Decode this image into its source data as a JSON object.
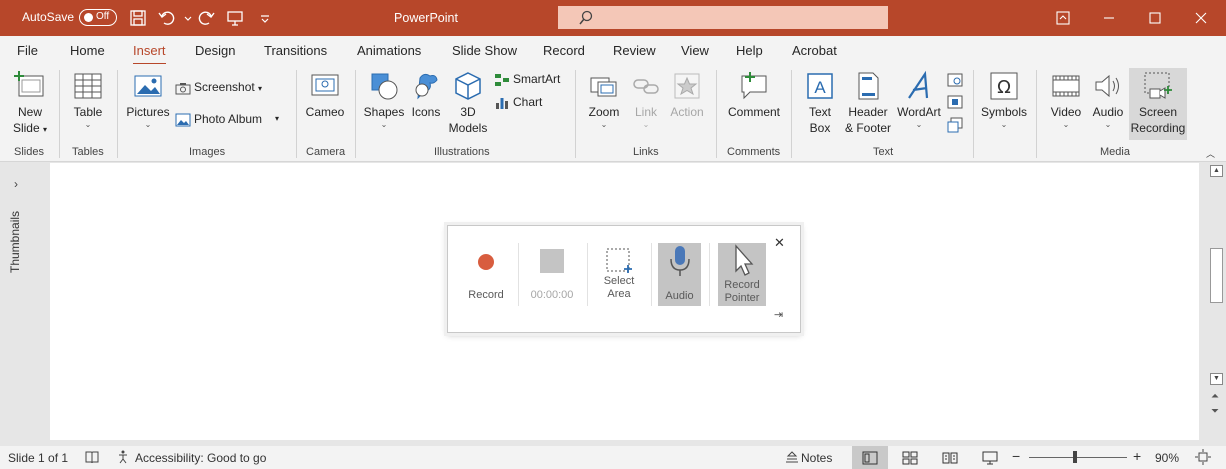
{
  "titlebar": {
    "autosave_label": "AutoSave",
    "autosave_state": "Off",
    "app_title": "PowerPoint"
  },
  "tabs": [
    "File",
    "Home",
    "Insert",
    "Design",
    "Transitions",
    "Animations",
    "Slide Show",
    "Record",
    "Review",
    "View",
    "Help",
    "Acrobat"
  ],
  "active_tab": "Insert",
  "ribbon": {
    "new_slide": [
      "New",
      "Slide"
    ],
    "table": "Table",
    "pictures": "Pictures",
    "screenshot": "Screenshot",
    "photo_album": "Photo Album",
    "cameo": "Cameo",
    "shapes": "Shapes",
    "icons": "Icons",
    "models": [
      "3D",
      "Models"
    ],
    "smartart": "SmartArt",
    "chart": "Chart",
    "zoom": "Zoom",
    "link": "Link",
    "action": "Action",
    "comment": "Comment",
    "textbox": [
      "Text",
      "Box"
    ],
    "header_footer": [
      "Header",
      "& Footer"
    ],
    "wordart": "WordArt",
    "symbols": "Symbols",
    "video": "Video",
    "audio": "Audio",
    "screen_recording": [
      "Screen",
      "Recording"
    ],
    "groups": {
      "slides": "Slides",
      "tables": "Tables",
      "images": "Images",
      "camera": "Camera",
      "illustrations": "Illustrations",
      "links": "Links",
      "comments": "Comments",
      "text": "Text",
      "media": "Media"
    }
  },
  "thumbnails_label": "Thumbnails",
  "recorder": {
    "record": "Record",
    "time": "00:00:00",
    "select_area": [
      "Select",
      "Area"
    ],
    "audio": "Audio",
    "record_pointer": [
      "Record",
      "Pointer"
    ]
  },
  "statusbar": {
    "slide_info": "Slide 1 of 1",
    "accessibility": "Accessibility: Good to go",
    "notes": "Notes",
    "zoom": "90%"
  },
  "colors": {
    "accent": "#b7472a",
    "record_dot": "#d85d3f"
  }
}
